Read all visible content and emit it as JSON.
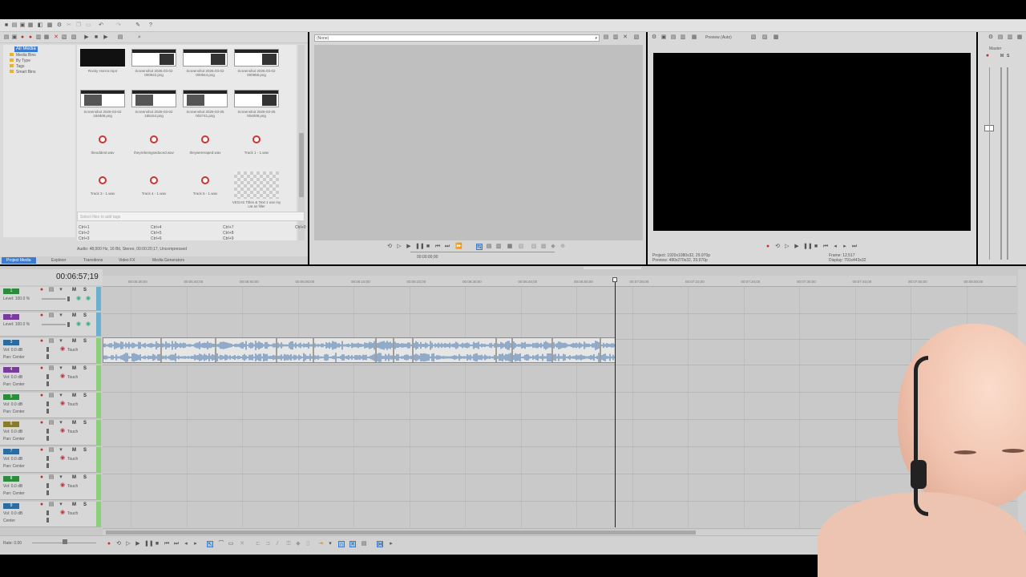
{
  "media_tabs": [
    "Project Media",
    "Explorer",
    "Transitions",
    "Video FX",
    "Media Generators"
  ],
  "media_tree": [
    "All Media",
    "Media Bins",
    "By Type",
    "Tags",
    "Smart Bins"
  ],
  "media_items": [
    {
      "label": "Rocky Horror.mp4",
      "kind": "black"
    },
    {
      "label": "Screenshot 2026-03-02 000922.png",
      "kind": "shot"
    },
    {
      "label": "Screenshot 2026-03-02 000944.png",
      "kind": "shot"
    },
    {
      "label": "Screenshot 2026-03-02 000958.png",
      "kind": "shot"
    },
    {
      "label": "Screenshot 2026-03-02 184808.png",
      "kind": "shot-b"
    },
    {
      "label": "Screenshot 2026-03-02 185154.png",
      "kind": "shot-b"
    },
    {
      "label": "Screenshot 2026-03-05 002741.png",
      "kind": "shot-b"
    },
    {
      "label": "Screenshot 2026-03-05 004008.png",
      "kind": "shot"
    },
    {
      "label": "theoddest.wav",
      "kind": "wav"
    },
    {
      "label": "theyrebeingseduced.wav",
      "kind": "wav"
    },
    {
      "label": "theywereraped.wav",
      "kind": "wav"
    },
    {
      "label": "Track 1 - 1.wav",
      "kind": "wav"
    },
    {
      "label": "Track 3 - 1.wav",
      "kind": "wav"
    },
    {
      "label": "Track 4 - 1.wav",
      "kind": "wav"
    },
    {
      "label": "Track 6 - 1.wav",
      "kind": "wav"
    },
    {
      "label": "VEGAS Titles & Text 1 use my cat as filler",
      "kind": "checker"
    }
  ],
  "media_search_placeholder": "Select files to add tags",
  "media_shortcuts": [
    "Ctrl+1",
    "Ctrl+4",
    "Ctrl+7",
    "Ctrl+2",
    "Ctrl+5",
    "Ctrl+8",
    "Ctrl+3",
    "Ctrl+6",
    "Ctrl+9",
    "Ctrl+0"
  ],
  "media_status": "Audio: 48,000 Hz, 16 Bit, Stereo, 00:00:20;17, Uncompressed",
  "trimmer_dropdown": "(None)",
  "trimmer_time_in": "00:00:00;00",
  "preview_quality": "Preview (Auto)",
  "preview_project": "Project: 1920x1080x32, 29.970p",
  "preview_preview": "Preview: 480x270x32, 29.970p",
  "preview_frame": "Frame: 12,517",
  "preview_display": "Display: 791x443x32",
  "master_label": "Master",
  "timecode": "00:06:57;19",
  "ruler_labels": [
    "00:05:30;00",
    "00:05:40;00",
    "00:05:50;00",
    "00:06:00;00",
    "00:06:10;00",
    "00:06:20;00",
    "00:06:30;00",
    "00:06:40;00",
    "00:06:50;00",
    "00:07:00;00",
    "00:07:10;00",
    "00:07:20;00",
    "00:07:30;00",
    "00:07:40;00",
    "00:07:50;00",
    "00:08:00;00"
  ],
  "video_tracks": [
    {
      "num": "1",
      "level": "Level: 100.0 %",
      "color": "#2c8c3c"
    },
    {
      "num": "2",
      "level": "Level: 100.0 %",
      "color": "#7a3c9c"
    }
  ],
  "audio_tracks": [
    {
      "num": "3",
      "vol": "Vol: 0.0 dB",
      "pan": "Pan: Center",
      "touch": "Touch",
      "color": "#2c6ca0"
    },
    {
      "num": "4",
      "vol": "Vol: 0.0 dB",
      "pan": "Pan: Center",
      "touch": "Touch",
      "color": "#7a3c9c"
    },
    {
      "num": "5",
      "vol": "Vol: 0.0 dB",
      "pan": "Pan: Center",
      "touch": "Touch",
      "color": "#2c8c3c"
    },
    {
      "num": "6",
      "vol": "Vol: 0.0 dB",
      "pan": "Pan: Center",
      "touch": "Touch",
      "color": "#8a7a2c"
    },
    {
      "num": "7",
      "vol": "Vol: 0.0 dB",
      "pan": "Pan: Center",
      "touch": "Touch",
      "color": "#2c6ca0"
    },
    {
      "num": "8",
      "vol": "Vol: 0.0 dB",
      "pan": "Pan: Center",
      "touch": "Touch",
      "color": "#2c8c3c"
    },
    {
      "num": "9",
      "vol": "Vol: 0.0 dB",
      "pan": "Center",
      "touch": "Touch",
      "color": "#2c6ca0"
    }
  ],
  "rate": "Rate: 0.00",
  "colors": {
    "app_bg": "#d9d9d9",
    "timeline_bg": "#c8c8c8",
    "preview_black": "#000000",
    "audio_event": "#e6e6e6",
    "waveform": "#3a6ea8",
    "track_strip": "#6cb0d0"
  }
}
